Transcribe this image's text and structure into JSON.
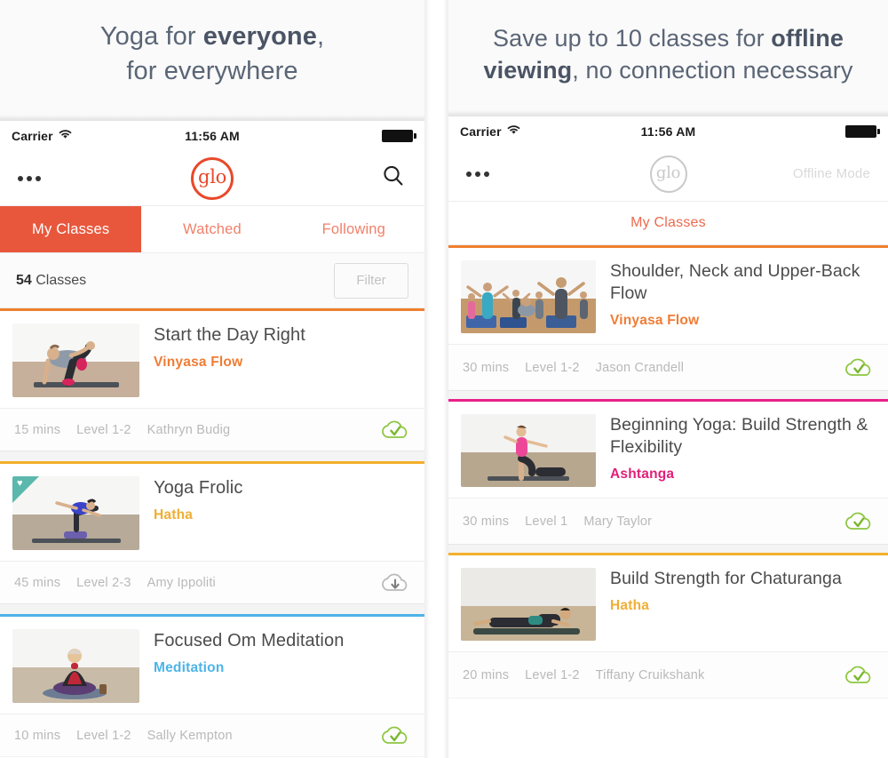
{
  "left": {
    "caption": {
      "line1_pre": "Yoga for ",
      "line1_bold": "everyone",
      "line1_post": ",",
      "line2": "for everywhere"
    },
    "statusbar": {
      "carrier": "Carrier",
      "time": "11:56 AM",
      "wifi_icon": "wifi-icon",
      "battery_icon": "battery-full-icon"
    },
    "navbar": {
      "menu_icon": "overflow-menu-icon",
      "logo": "glo",
      "search_icon": "search-icon"
    },
    "tabs": [
      {
        "label": "My Classes",
        "active": true
      },
      {
        "label": "Watched",
        "active": false
      },
      {
        "label": "Following",
        "active": false
      }
    ],
    "count": {
      "number": "54",
      "label": " Classes"
    },
    "filter": {
      "label": "Filter"
    },
    "classes": [
      {
        "title": "Start the Day Right",
        "style": "Vinyasa Flow",
        "style_color": "#f07c35",
        "accent": "#f0802f",
        "duration": "15 mins",
        "level": "Level 1-2",
        "teacher": "Kathryn Budig",
        "status_icon": "cloud-downloaded-check-icon",
        "favorite": false
      },
      {
        "title": "Yoga Frolic",
        "style": "Hatha",
        "style_color": "#f0ae33",
        "accent": "#f3b02c",
        "duration": "45 mins",
        "level": "Level 2-3",
        "teacher": "Amy Ippoliti",
        "status_icon": "cloud-download-icon",
        "favorite": true
      },
      {
        "title": "Focused Om Meditation",
        "style": "Meditation",
        "style_color": "#4db4e8",
        "accent": "#4fb3e8",
        "duration": "10 mins",
        "level": "Level 1-2",
        "teacher": "Sally Kempton",
        "status_icon": "cloud-downloaded-check-icon",
        "favorite": false
      }
    ]
  },
  "right": {
    "caption": {
      "line1_pre": "Save up to 10 classes for ",
      "line1_bold": "offline",
      "line2_bold": "viewing",
      "line2_post": ", no connection necessary"
    },
    "statusbar": {
      "carrier": "Carrier",
      "time": "11:56 AM",
      "wifi_icon": "wifi-icon",
      "battery_icon": "battery-full-icon"
    },
    "navbar": {
      "menu_icon": "overflow-menu-icon",
      "logo": "glo",
      "offline_label": "Offline Mode"
    },
    "tab": {
      "label": "My Classes"
    },
    "classes": [
      {
        "title": "Shoulder, Neck and Upper-Back Flow",
        "style": "Vinyasa Flow",
        "style_color": "#f07c35",
        "accent": "#f0802f",
        "duration": "30 mins",
        "level": "Level 1-2",
        "teacher": "Jason Crandell",
        "status_icon": "cloud-downloaded-check-icon"
      },
      {
        "title": "Beginning Yoga: Build Strength & Flexibility",
        "style": "Ashtanga",
        "style_color": "#e21e78",
        "accent": "#e8208a",
        "duration": "30 mins",
        "level": "Level 1",
        "teacher": "Mary Taylor",
        "status_icon": "cloud-downloaded-check-icon"
      },
      {
        "title": "Build Strength for Chaturanga",
        "style": "Hatha",
        "style_color": "#f0ae33",
        "accent": "#f3b02c",
        "duration": "20 mins",
        "level": "Level 1-2",
        "teacher": "Tiffany Cruikshank",
        "status_icon": "cloud-downloaded-check-icon"
      }
    ]
  },
  "colors": {
    "brand_orange": "#e8492b",
    "tab_active_bg": "#e8573c",
    "tab_inactive_text": "#f0816b",
    "downloaded_green": "#8cc63f",
    "caption_text": "#5a6576"
  }
}
